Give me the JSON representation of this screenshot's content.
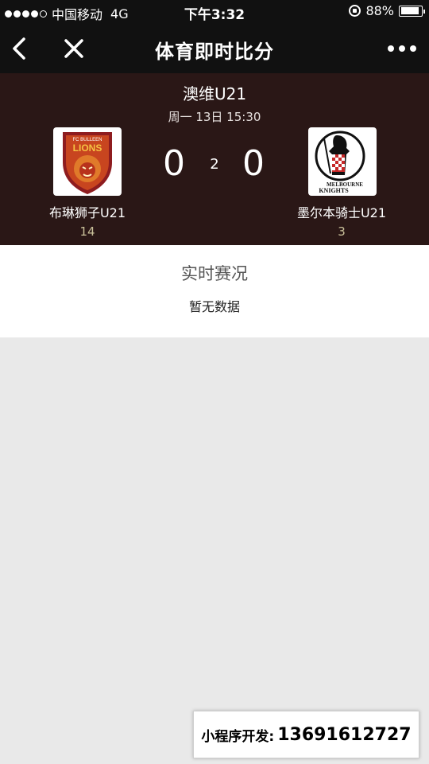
{
  "status_bar": {
    "carrier": "中国移动",
    "network": "4G",
    "time": "下午3:32",
    "battery_percent": "88%",
    "battery_level": 0.88,
    "signal_bars_filled": 4,
    "signal_bars_total": 5
  },
  "nav": {
    "title": "体育即时比分",
    "back_icon": "chevron-left-icon",
    "close_icon": "close-icon",
    "more_icon": "more-dots-icon"
  },
  "match": {
    "league": "澳维U21",
    "datetime": "周一 13日 15:30",
    "period": "2",
    "home": {
      "name": "布琳狮子U21",
      "score": "0",
      "rank": "14",
      "logo_text_top": "FC BULLEEN",
      "logo_text_main": "LIONS"
    },
    "away": {
      "name": "墨尔本骑士U21",
      "score": "0",
      "rank": "3",
      "logo_text_1": "MELBOURNE",
      "logo_text_2": "KNIGHTS"
    }
  },
  "live": {
    "title": "实时赛况",
    "empty_text": "暂无数据"
  },
  "promo": {
    "label": "小程序开发:",
    "phone": "13691612727"
  },
  "colors": {
    "nav_bg": "#111111",
    "header_bg": "#2a1716",
    "rank_color": "#c9c09a",
    "page_bg": "#e9e9e9"
  }
}
